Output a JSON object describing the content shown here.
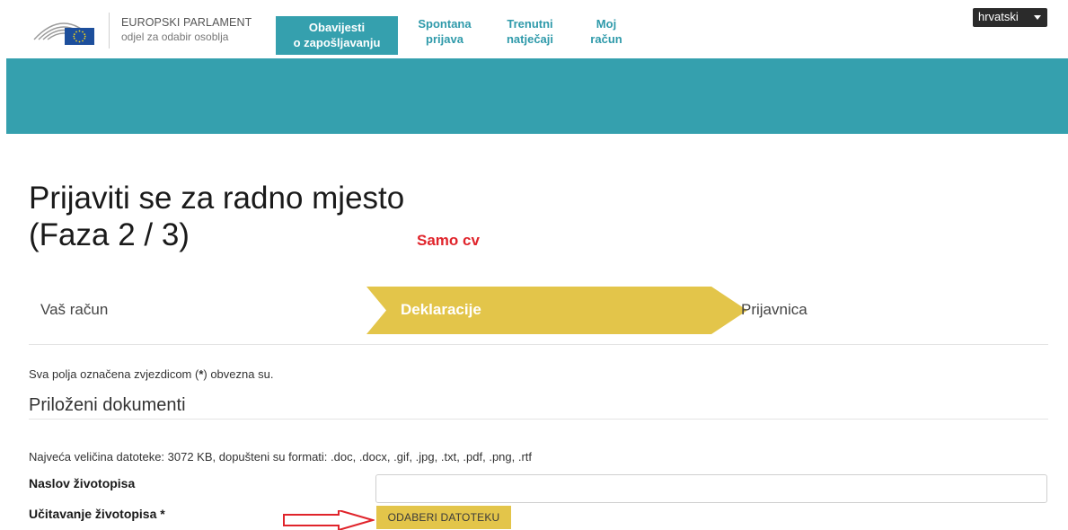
{
  "header": {
    "org_name": "EUROPSKI PARLAMENT",
    "org_sub": "odjel za odabir osoblja",
    "nav": [
      {
        "line1": "Obavijesti",
        "line2": "o zapošljavanju"
      },
      {
        "line1": "Spontana",
        "line2": "prijava"
      },
      {
        "line1": "Trenutni",
        "line2": "natječaji"
      },
      {
        "line1": "Moj",
        "line2": "račun"
      }
    ],
    "language": "hrvatski"
  },
  "page": {
    "title_line1": "Prijaviti se za radno mjesto",
    "title_line2": "(Faza 2 / 3)",
    "annotation": "Samo cv"
  },
  "steps": [
    "Vaš račun",
    "Deklaracije",
    "Prijavnica"
  ],
  "form": {
    "required_note_before": "Sva polja označena zvjezdicom (",
    "required_note_star": "*",
    "required_note_after": ") obvezna su.",
    "section_title": "Priloženi dokumenti",
    "file_info": "Najveća veličina datoteke: 3072 KB, dopušteni su formati: .doc, .docx, .gif, .jpg, .txt, .pdf, .png, .rtf",
    "cv_title_label": "Naslov životopisa",
    "cv_upload_label": "Učitavanje životopisa *",
    "choose_file_label": "ODABERI DATOTEKU"
  },
  "colors": {
    "teal": "#35a0ae",
    "yellow_step": "#e3c54a",
    "annotation_red": "#e0242b"
  }
}
